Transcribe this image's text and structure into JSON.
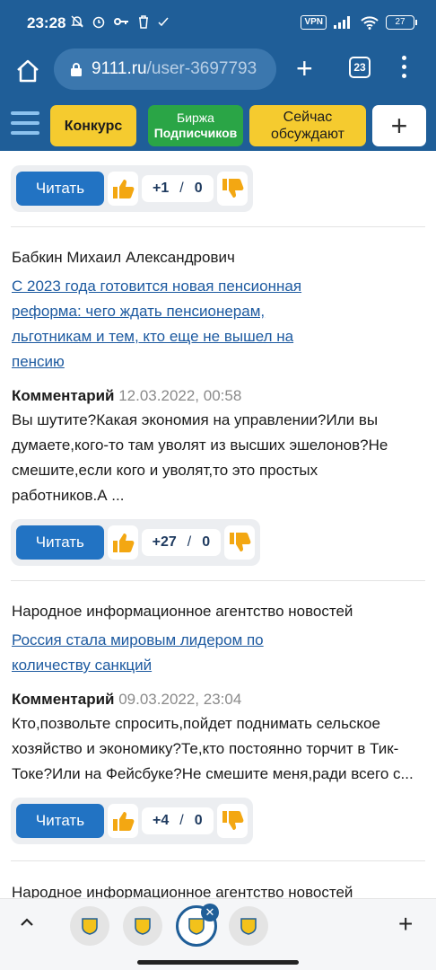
{
  "status_bar": {
    "time": "23:28",
    "vpn": "VPN",
    "battery": "27"
  },
  "browser": {
    "url_host": "9111.ru",
    "url_path": "/user-3697793",
    "tab_count": "23"
  },
  "site_nav": {
    "konkurs": "Конкурс",
    "birzha_line1": "Биржа",
    "birzha_line2": "Подписчиков",
    "seichas_line1": "Сейчас",
    "seichas_line2": "обсуждают",
    "plus": "+"
  },
  "read_label": "Читать",
  "items": [
    {
      "likes": "+1",
      "dislikes": "0"
    },
    {
      "author": "Бабкин Михаил Александрович",
      "link_lines": [
        "С 2023 года готовится новая пенсионная",
        "реформа: чего ждать пенсионерам,",
        "льготникам и тем, кто еще не вышел на",
        "пенсию"
      ],
      "comment_label": "Комментарий",
      "date": "12.03.2022, 00:58",
      "text_lines": [
        "Вы шутите?Какая экономия на управлении?Или вы",
        "думаете,кого-то там уволят из высших эшелонов?Не",
        "смешите,если кого и уволят,то это простых",
        "работников.А ..."
      ],
      "likes": "+27",
      "dislikes": "0"
    },
    {
      "author": "Народное информационное агентство новостей",
      "link_lines": [
        "Россия стала мировым лидером по",
        "количеству санкций"
      ],
      "comment_label": "Комментарий",
      "date": "09.03.2022, 23:04",
      "text_lines": [
        "Кто,позвольте спросить,пойдет поднимать сельское",
        "хозяйство и экономику?Те,кто постоянно торчит в Тик-",
        "Токе?Или на Фейсбуке?Не смешите меня,ради всего с..."
      ],
      "likes": "+4",
      "dislikes": "0"
    },
    {
      "author": "Народное информационное агентство новостей"
    }
  ],
  "colors": {
    "brand_blue": "#1f5e98",
    "read_button": "#2273c3",
    "yellow": "#f5cb2f",
    "green": "#2aa546",
    "thumb": "#f3a712"
  }
}
